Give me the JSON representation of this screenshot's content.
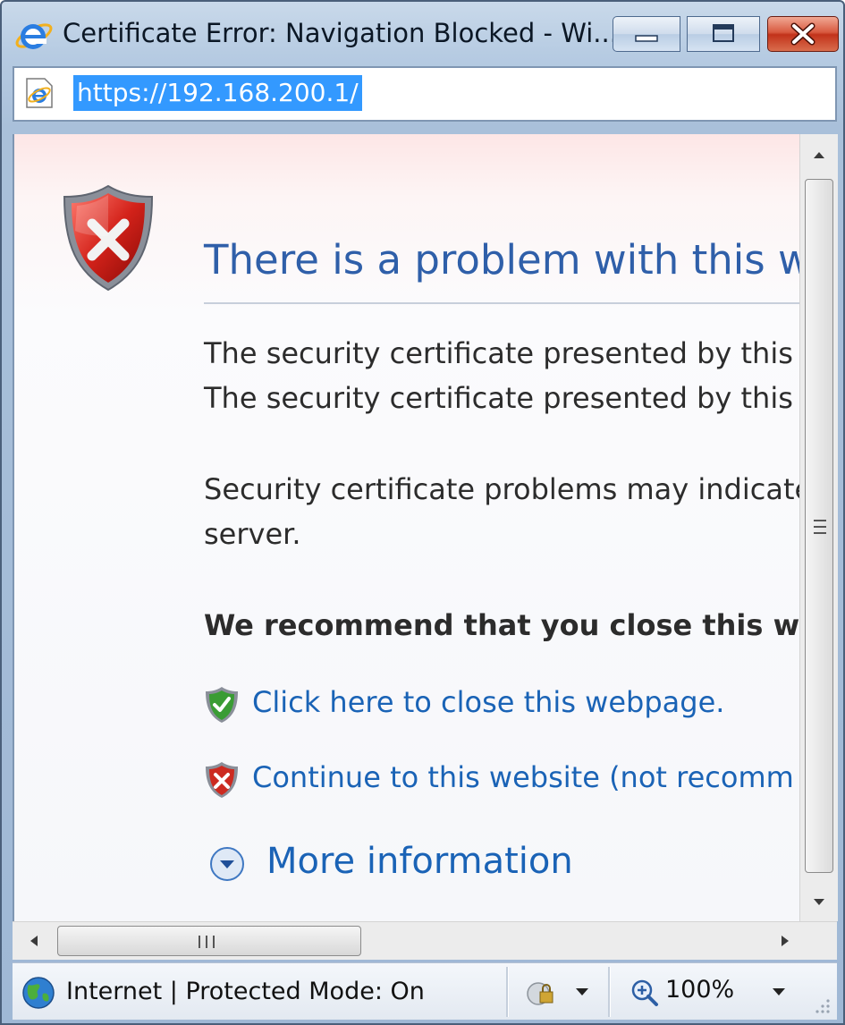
{
  "window": {
    "title": "Certificate Error: Navigation Blocked - Wi..."
  },
  "address_bar": {
    "url": "https://192.168.200.1/"
  },
  "page": {
    "heading": "There is a problem with this web",
    "para1_line1": "The security certificate presented by this v",
    "para1_line2": "The security certificate presented by this v",
    "para2_line1": "Security certificate problems may indicate",
    "para2_line2": "server.",
    "recommendation": "We recommend that you close this we",
    "close_link": "Click here to close this webpage.",
    "continue_link": "Continue to this website (not recomm",
    "more_info": "More information"
  },
  "status_bar": {
    "zone": "Internet | Protected Mode: On",
    "zoom": "100%"
  },
  "colors": {
    "heading_blue": "#2f5fa9",
    "link_blue": "#1a63b6",
    "selection": "#3399ff"
  },
  "icons": [
    "ie-logo-icon",
    "minimize-icon",
    "maximize-icon",
    "close-icon",
    "page-ie-icon",
    "shield-error-icon",
    "shield-ok-icon",
    "shield-warning-icon",
    "chevron-circle-down-icon",
    "globe-icon",
    "security-lock-icon",
    "zoom-icon"
  ]
}
